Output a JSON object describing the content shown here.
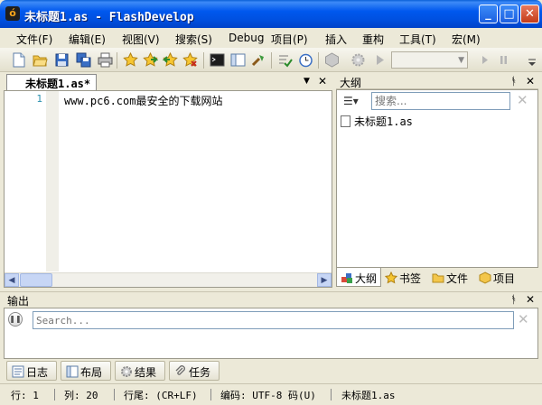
{
  "window": {
    "title": "未标题1.as - FlashDevelop",
    "app_icon_glyph": "ó",
    "minimize_glyph": "_",
    "maximize_glyph": "□",
    "close_glyph": "✕"
  },
  "menu": [
    "文件(F)",
    "编辑(E)",
    "视图(V)",
    "搜索(S)",
    "Debug",
    "项目(P)",
    "插入",
    "重构",
    "工具(T)",
    "宏(M)"
  ],
  "toolbar": {
    "icons": [
      "new-file-icon",
      "open-folder-icon",
      "save-icon",
      "save-all-icon",
      "print-icon",
      "bookmark-star-icon",
      "bookmark-next-icon",
      "bookmark-prev-icon",
      "bookmark-clear-icon",
      "command-prompt-icon",
      "panel-icon",
      "refactor-icon",
      "check-syntax-icon",
      "clock-icon",
      "build-cube-icon",
      "settings-gear-icon",
      "run-icon",
      "play-icon",
      "pause-icon"
    ],
    "config_combo_value": ""
  },
  "editor": {
    "tab_label": "未标题1.as*",
    "tab_menu_glyph": "▼",
    "tab_close_glyph": "✕",
    "line_number": "1",
    "code": "www.pc6.com最安全的下载网站",
    "scroll_left_glyph": "◀",
    "scroll_right_glyph": "▶"
  },
  "outline": {
    "title": "大纲",
    "pin_glyph": "ᚬ",
    "close_glyph": "✕",
    "sort_glyph": "☰▾",
    "search_placeholder": "搜索...",
    "clear_glyph": "✕",
    "file": "未标题1.as",
    "tabs": [
      "大纲",
      "书签",
      "文件",
      "项目"
    ]
  },
  "output": {
    "title": "输出",
    "pin_glyph": "ᚬ",
    "close_glyph": "✕",
    "pause_glyph": "❚❚",
    "search_placeholder": "Search...",
    "clear_glyph": "✕",
    "tabs": [
      "日志",
      "布局",
      "结果",
      "任务"
    ]
  },
  "status": {
    "line": "行: 1",
    "column": "列: 20",
    "eol": "行尾: (CR+LF)",
    "encoding": "编码: UTF-8 码(U)",
    "file": "未标题1.as"
  }
}
